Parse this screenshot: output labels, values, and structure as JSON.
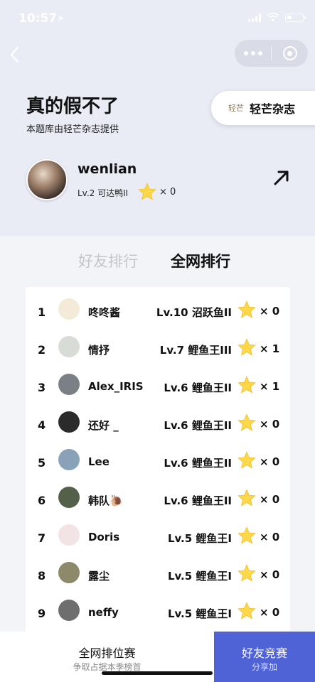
{
  "status": {
    "time": "10:57",
    "battery_level": 0.3
  },
  "header": {
    "title": "真的假不了",
    "subtitle": "本题库由轻芒杂志提供",
    "sponsor_logo": "轻芒",
    "sponsor_name": "轻芒杂志"
  },
  "me": {
    "name": "wenlian",
    "level": "Lv.2 可达鸭II",
    "stars": "× 0"
  },
  "tabs": {
    "friends": "好友排行",
    "global": "全网排行"
  },
  "ranking": [
    {
      "rank": "1",
      "name": "咚咚酱",
      "level": "Lv.10 沼跃鱼II",
      "stars": "× 0",
      "avatar_color": "#f3ead7"
    },
    {
      "rank": "2",
      "name": "情抒",
      "level": "Lv.7 鲤鱼王III",
      "stars": "× 1",
      "avatar_color": "#d8dcd6"
    },
    {
      "rank": "3",
      "name": "Alex_IRIS",
      "level": "Lv.6 鲤鱼王II",
      "stars": "× 1",
      "avatar_color": "#7b7f86"
    },
    {
      "rank": "4",
      "name": "还好 _",
      "level": "Lv.6 鲤鱼王II",
      "stars": "× 0",
      "avatar_color": "#2b2b2b"
    },
    {
      "rank": "5",
      "name": "Lee",
      "level": "Lv.6 鲤鱼王II",
      "stars": "× 0",
      "avatar_color": "#8aa2b8"
    },
    {
      "rank": "6",
      "name": "韩队🐌",
      "level": "Lv.6 鲤鱼王II",
      "stars": "× 0",
      "avatar_color": "#55604a"
    },
    {
      "rank": "7",
      "name": "Doris",
      "level": "Lv.5 鲤鱼王I",
      "stars": "× 0",
      "avatar_color": "#f2e4e4"
    },
    {
      "rank": "8",
      "name": "露尘",
      "level": "Lv.5 鲤鱼王I",
      "stars": "× 0",
      "avatar_color": "#8c8a6a"
    },
    {
      "rank": "9",
      "name": "neffy",
      "level": "Lv.5 鲤鱼王I",
      "stars": "× 0",
      "avatar_color": "#6e6e6e"
    }
  ],
  "bottom": {
    "left_title": "全网排位赛",
    "left_sub": "争取占据本季榜首",
    "right_title": "好友竞赛",
    "right_sub": "分享加"
  },
  "colors": {
    "accent": "#4f62d6",
    "star": "#ffd84a",
    "header_bg": "#e9ebf5"
  }
}
